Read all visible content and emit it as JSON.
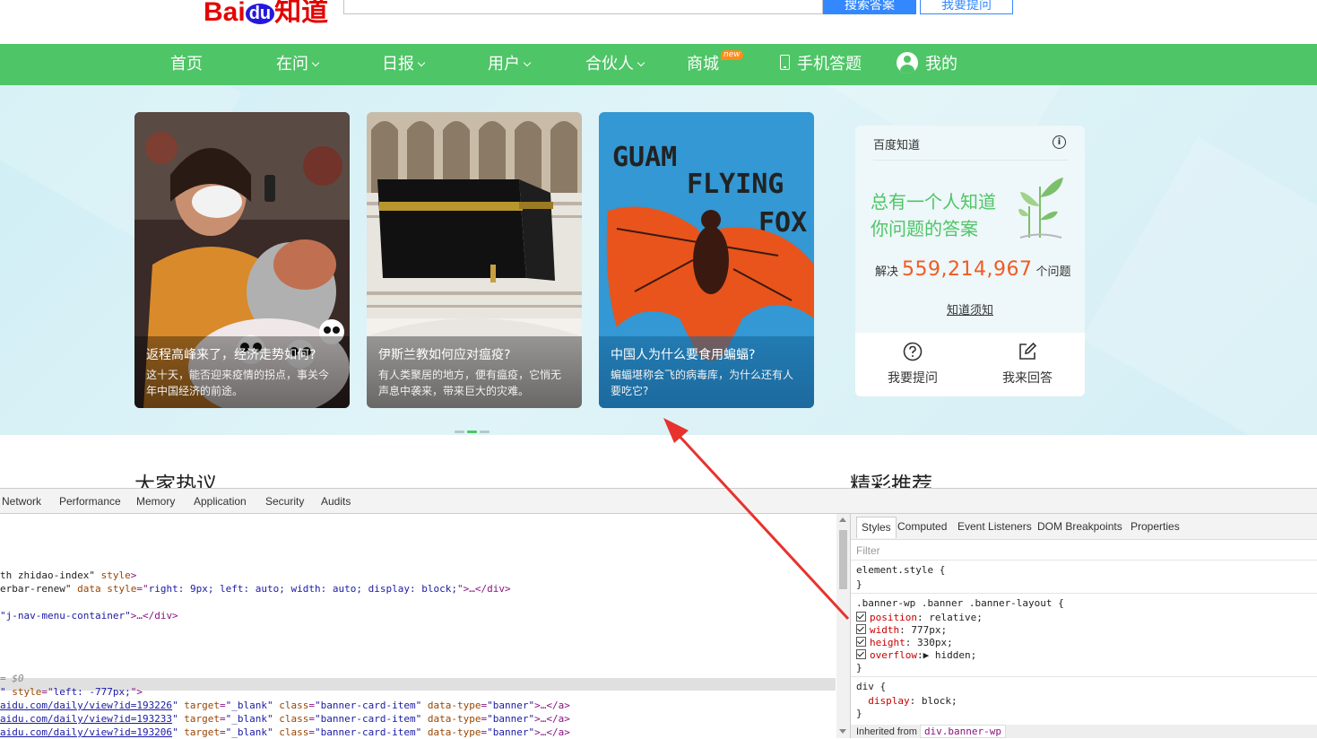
{
  "header": {
    "logo_text": "Bai",
    "logo_du": "du",
    "logo_zhidao": "知道",
    "search_button": "搜索答案",
    "ask_button": "我要提问"
  },
  "nav": {
    "items": [
      {
        "label": "首页",
        "dropdown": false
      },
      {
        "label": "在问",
        "dropdown": true
      },
      {
        "label": "日报",
        "dropdown": true
      },
      {
        "label": "用户",
        "dropdown": true
      },
      {
        "label": "合伙人",
        "dropdown": true
      },
      {
        "label": "商城",
        "dropdown": false,
        "badge": "new"
      },
      {
        "label": "手机答题",
        "icon": "phone-icon"
      },
      {
        "label": "我的",
        "icon": "user-icon"
      }
    ],
    "color": "#4ec566"
  },
  "banner": {
    "cards": [
      {
        "title": "返程高峰来了，经济走势如何?",
        "desc": "这十天，能否迎来疫情的拐点，事关今年中国经济的前途。"
      },
      {
        "title": "伊斯兰教如何应对瘟疫?",
        "desc": "有人类聚居的地方，便有瘟疫，它悄无声息中袭来，带来巨大的灾难。"
      },
      {
        "title": "中国人为什么要食用蝙蝠?",
        "desc": "蝙蝠堪称会飞的病毒库，为什么还有人要吃它?"
      }
    ],
    "active_dot": 1,
    "dot_count": 3,
    "card3_image_text": [
      "GUAM",
      "FLYING",
      "FOX"
    ]
  },
  "side": {
    "header": "百度知道",
    "slogan_line1": "总有一个人知道",
    "slogan_line2": "你问题的答案",
    "solved_prefix": "解决",
    "solved_count": "559,214,967",
    "solved_suffix": "个问题",
    "know_link": "知道须知",
    "ask_action": "我要提问",
    "answer_action": "我来回答"
  },
  "sections": {
    "left_title": "大家热议",
    "right_title": "精彩推荐"
  },
  "devtools": {
    "tabs": [
      "Network",
      "Performance",
      "Memory",
      "Application",
      "Security",
      "Audits"
    ],
    "code_lines": [
      {
        "parts": [
          {
            "t": "tx",
            "v": "th zhidao-index\""
          },
          {
            "t": "an",
            "v": " style"
          },
          {
            "t": "tag",
            "v": ">"
          }
        ]
      },
      {
        "parts": [
          {
            "t": "tx",
            "v": "erbar-renew\""
          },
          {
            "t": "an",
            "v": " data style"
          },
          {
            "t": "tag",
            "v": "=\""
          },
          {
            "t": "av",
            "v": "right: 9px; left: auto; width: auto; display: block;"
          },
          {
            "t": "tag",
            "v": "\">…</div>"
          }
        ]
      },
      {
        "parts": [
          {
            "t": "av",
            "v": "\"j-nav-menu-container\""
          },
          {
            "t": "tag",
            "v": ">…</div>"
          }
        ]
      },
      {
        "parts": [
          {
            "t": "tx",
            "v": "= $0"
          }
        ]
      },
      {
        "parts": [
          {
            "t": "av",
            "v": "\""
          },
          {
            "t": "an",
            "v": " style"
          },
          {
            "t": "tag",
            "v": "=\""
          },
          {
            "t": "av",
            "v": "left: -777px;"
          },
          {
            "t": "tag",
            "v": "\">"
          }
        ]
      },
      {
        "parts": [
          {
            "t": "lk",
            "v": "aidu.com/daily/view?id=193226"
          },
          {
            "t": "av",
            "v": "\""
          },
          {
            "t": "an",
            "v": " target"
          },
          {
            "t": "tag",
            "v": "="
          },
          {
            "t": "av",
            "v": "\"_blank\""
          },
          {
            "t": "an",
            "v": " class"
          },
          {
            "t": "tag",
            "v": "="
          },
          {
            "t": "av",
            "v": "\"banner-card-item\""
          },
          {
            "t": "an",
            "v": " data-type"
          },
          {
            "t": "tag",
            "v": "="
          },
          {
            "t": "av",
            "v": "\"banner\""
          },
          {
            "t": "tag",
            "v": ">…</a>"
          }
        ]
      },
      {
        "parts": [
          {
            "t": "lk",
            "v": "aidu.com/daily/view?id=193233"
          },
          {
            "t": "av",
            "v": "\""
          },
          {
            "t": "an",
            "v": " target"
          },
          {
            "t": "tag",
            "v": "="
          },
          {
            "t": "av",
            "v": "\"_blank\""
          },
          {
            "t": "an",
            "v": " class"
          },
          {
            "t": "tag",
            "v": "="
          },
          {
            "t": "av",
            "v": "\"banner-card-item\""
          },
          {
            "t": "an",
            "v": " data-type"
          },
          {
            "t": "tag",
            "v": "="
          },
          {
            "t": "av",
            "v": "\"banner\""
          },
          {
            "t": "tag",
            "v": ">…</a>"
          }
        ]
      },
      {
        "parts": [
          {
            "t": "lk",
            "v": "aidu.com/daily/view?id=193206"
          },
          {
            "t": "av",
            "v": "\""
          },
          {
            "t": "an",
            "v": " target"
          },
          {
            "t": "tag",
            "v": "="
          },
          {
            "t": "av",
            "v": "\"_blank\""
          },
          {
            "t": "an",
            "v": " class"
          },
          {
            "t": "tag",
            "v": "="
          },
          {
            "t": "av",
            "v": "\"banner-card-item\""
          },
          {
            "t": "an",
            "v": " data-type"
          },
          {
            "t": "tag",
            "v": "="
          },
          {
            "t": "av",
            "v": "\"banner\""
          },
          {
            "t": "tag",
            "v": ">…</a>"
          }
        ]
      }
    ],
    "styles_tabs": [
      "Styles",
      "Computed",
      "Event Listeners",
      "DOM Breakpoints",
      "Properties"
    ],
    "filter_placeholder": "Filter",
    "element_style": "element.style {",
    "close_brace": "}",
    "rule_selector": ".banner-wp .banner .banner-layout {",
    "declarations": [
      {
        "prop": "position",
        "value": "relative;"
      },
      {
        "prop": "width",
        "value": "777px;"
      },
      {
        "prop": "height",
        "value": "330px;"
      },
      {
        "prop": "overflow",
        "value": "hidden;",
        "expand": true
      }
    ],
    "div_selector": "div {",
    "div_decl": {
      "prop": "display",
      "value": "block;"
    },
    "inherited_label": "Inherited from",
    "inherited_tag": "div.banner-wp"
  },
  "annotation": {
    "arrow_color": "#e8322e"
  }
}
